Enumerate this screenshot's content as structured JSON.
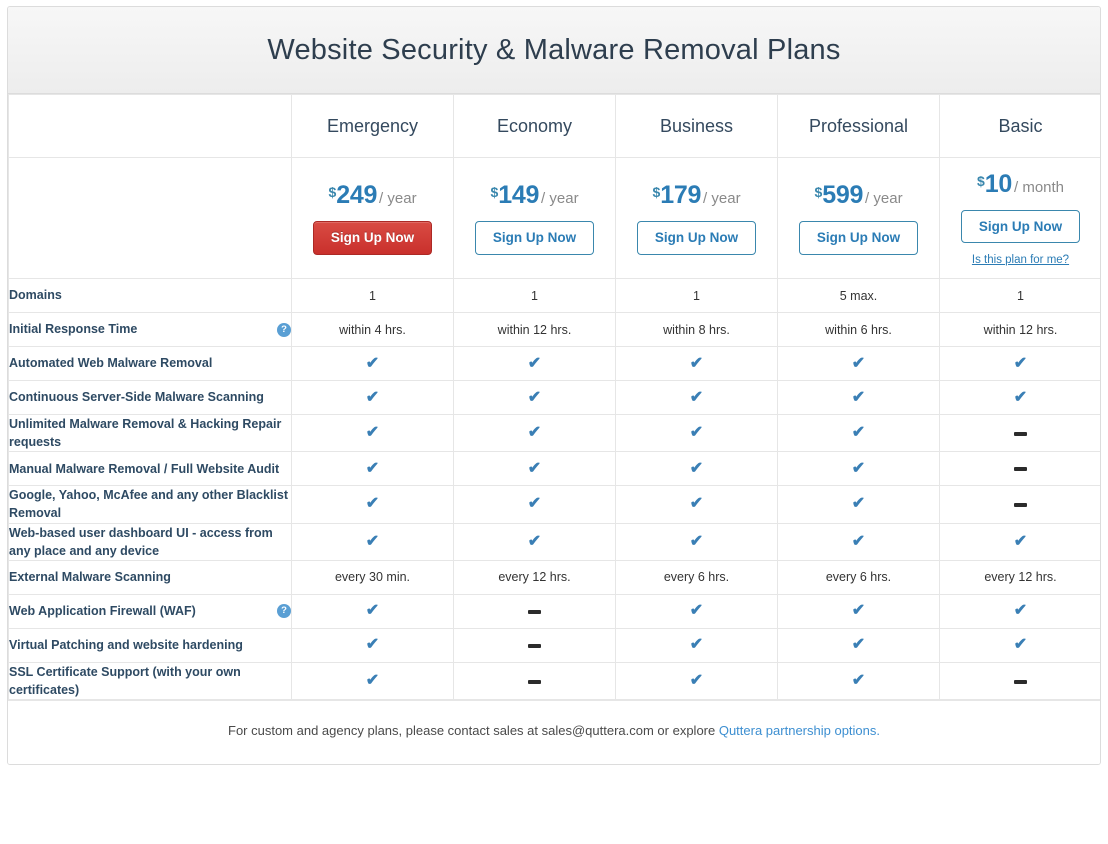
{
  "page": {
    "title": "Website Security & Malware Removal Plans"
  },
  "plans": [
    {
      "name": "Emergency",
      "currency": "$",
      "amount": "249",
      "period": "/ year",
      "cta": "Sign Up Now",
      "cta_style": "primary",
      "hint": null
    },
    {
      "name": "Economy",
      "currency": "$",
      "amount": "149",
      "period": "/ year",
      "cta": "Sign Up Now",
      "cta_style": "outline",
      "hint": null
    },
    {
      "name": "Business",
      "currency": "$",
      "amount": "179",
      "period": "/ year",
      "cta": "Sign Up Now",
      "cta_style": "outline",
      "hint": null
    },
    {
      "name": "Professional",
      "currency": "$",
      "amount": "599",
      "period": "/ year",
      "cta": "Sign Up Now",
      "cta_style": "outline",
      "hint": null
    },
    {
      "name": "Basic",
      "currency": "$",
      "amount": "10",
      "period": "/ month",
      "cta": "Sign Up Now",
      "cta_style": "outline",
      "hint": "Is this plan for me?"
    }
  ],
  "help_icon_glyph": "?",
  "check_glyph": "✔",
  "features": [
    {
      "label": "Domains",
      "help": false,
      "values": [
        "1",
        "1",
        "1",
        "5 max.",
        "1"
      ]
    },
    {
      "label": "Initial Response Time",
      "help": true,
      "values": [
        "within 4 hrs.",
        "within 12 hrs.",
        "within 8 hrs.",
        "within 6 hrs.",
        "within 12 hrs."
      ]
    },
    {
      "label": "Automated Web Malware Removal",
      "help": false,
      "values": [
        "check",
        "check",
        "check",
        "check",
        "check"
      ]
    },
    {
      "label": "Continuous Server-Side Malware Scanning",
      "help": false,
      "values": [
        "check",
        "check",
        "check",
        "check",
        "check"
      ]
    },
    {
      "label": "Unlimited Malware Removal & Hacking Repair requests",
      "help": false,
      "values": [
        "check",
        "check",
        "check",
        "check",
        "dash"
      ]
    },
    {
      "label": "Manual Malware Removal / Full Website Audit",
      "help": false,
      "values": [
        "check",
        "check",
        "check",
        "check",
        "dash"
      ]
    },
    {
      "label": "Google, Yahoo, McAfee and any other Blacklist Removal",
      "help": false,
      "values": [
        "check",
        "check",
        "check",
        "check",
        "dash"
      ]
    },
    {
      "label": "Web-based user dashboard UI - access from any place and any device",
      "help": false,
      "values": [
        "check",
        "check",
        "check",
        "check",
        "check"
      ]
    },
    {
      "label": "External Malware Scanning",
      "help": false,
      "values": [
        "every 30 min.",
        "every 12 hrs.",
        "every 6 hrs.",
        "every 6 hrs.",
        "every 12 hrs."
      ]
    },
    {
      "label": "Web Application Firewall (WAF)",
      "help": true,
      "values": [
        "check",
        "dash",
        "check",
        "check",
        "check"
      ]
    },
    {
      "label": "Virtual Patching and website hardening",
      "help": false,
      "values": [
        "check",
        "dash",
        "check",
        "check",
        "check"
      ]
    },
    {
      "label": "SSL Certificate Support (with your own certificates)",
      "help": false,
      "values": [
        "check",
        "dash",
        "check",
        "check",
        "dash"
      ]
    }
  ],
  "footer": {
    "text_before": "For custom and agency plans, please contact sales at sales@quttera.com or explore ",
    "link_text": "Quttera partnership options.",
    "link_color": "#3d8fd1"
  },
  "colors": {
    "accent_blue": "#2b7cb5",
    "link_blue": "#3d8fd1",
    "primary_red": "#c9302c",
    "title_text": "#2e3e4e",
    "feature_text": "#2e4a63"
  }
}
